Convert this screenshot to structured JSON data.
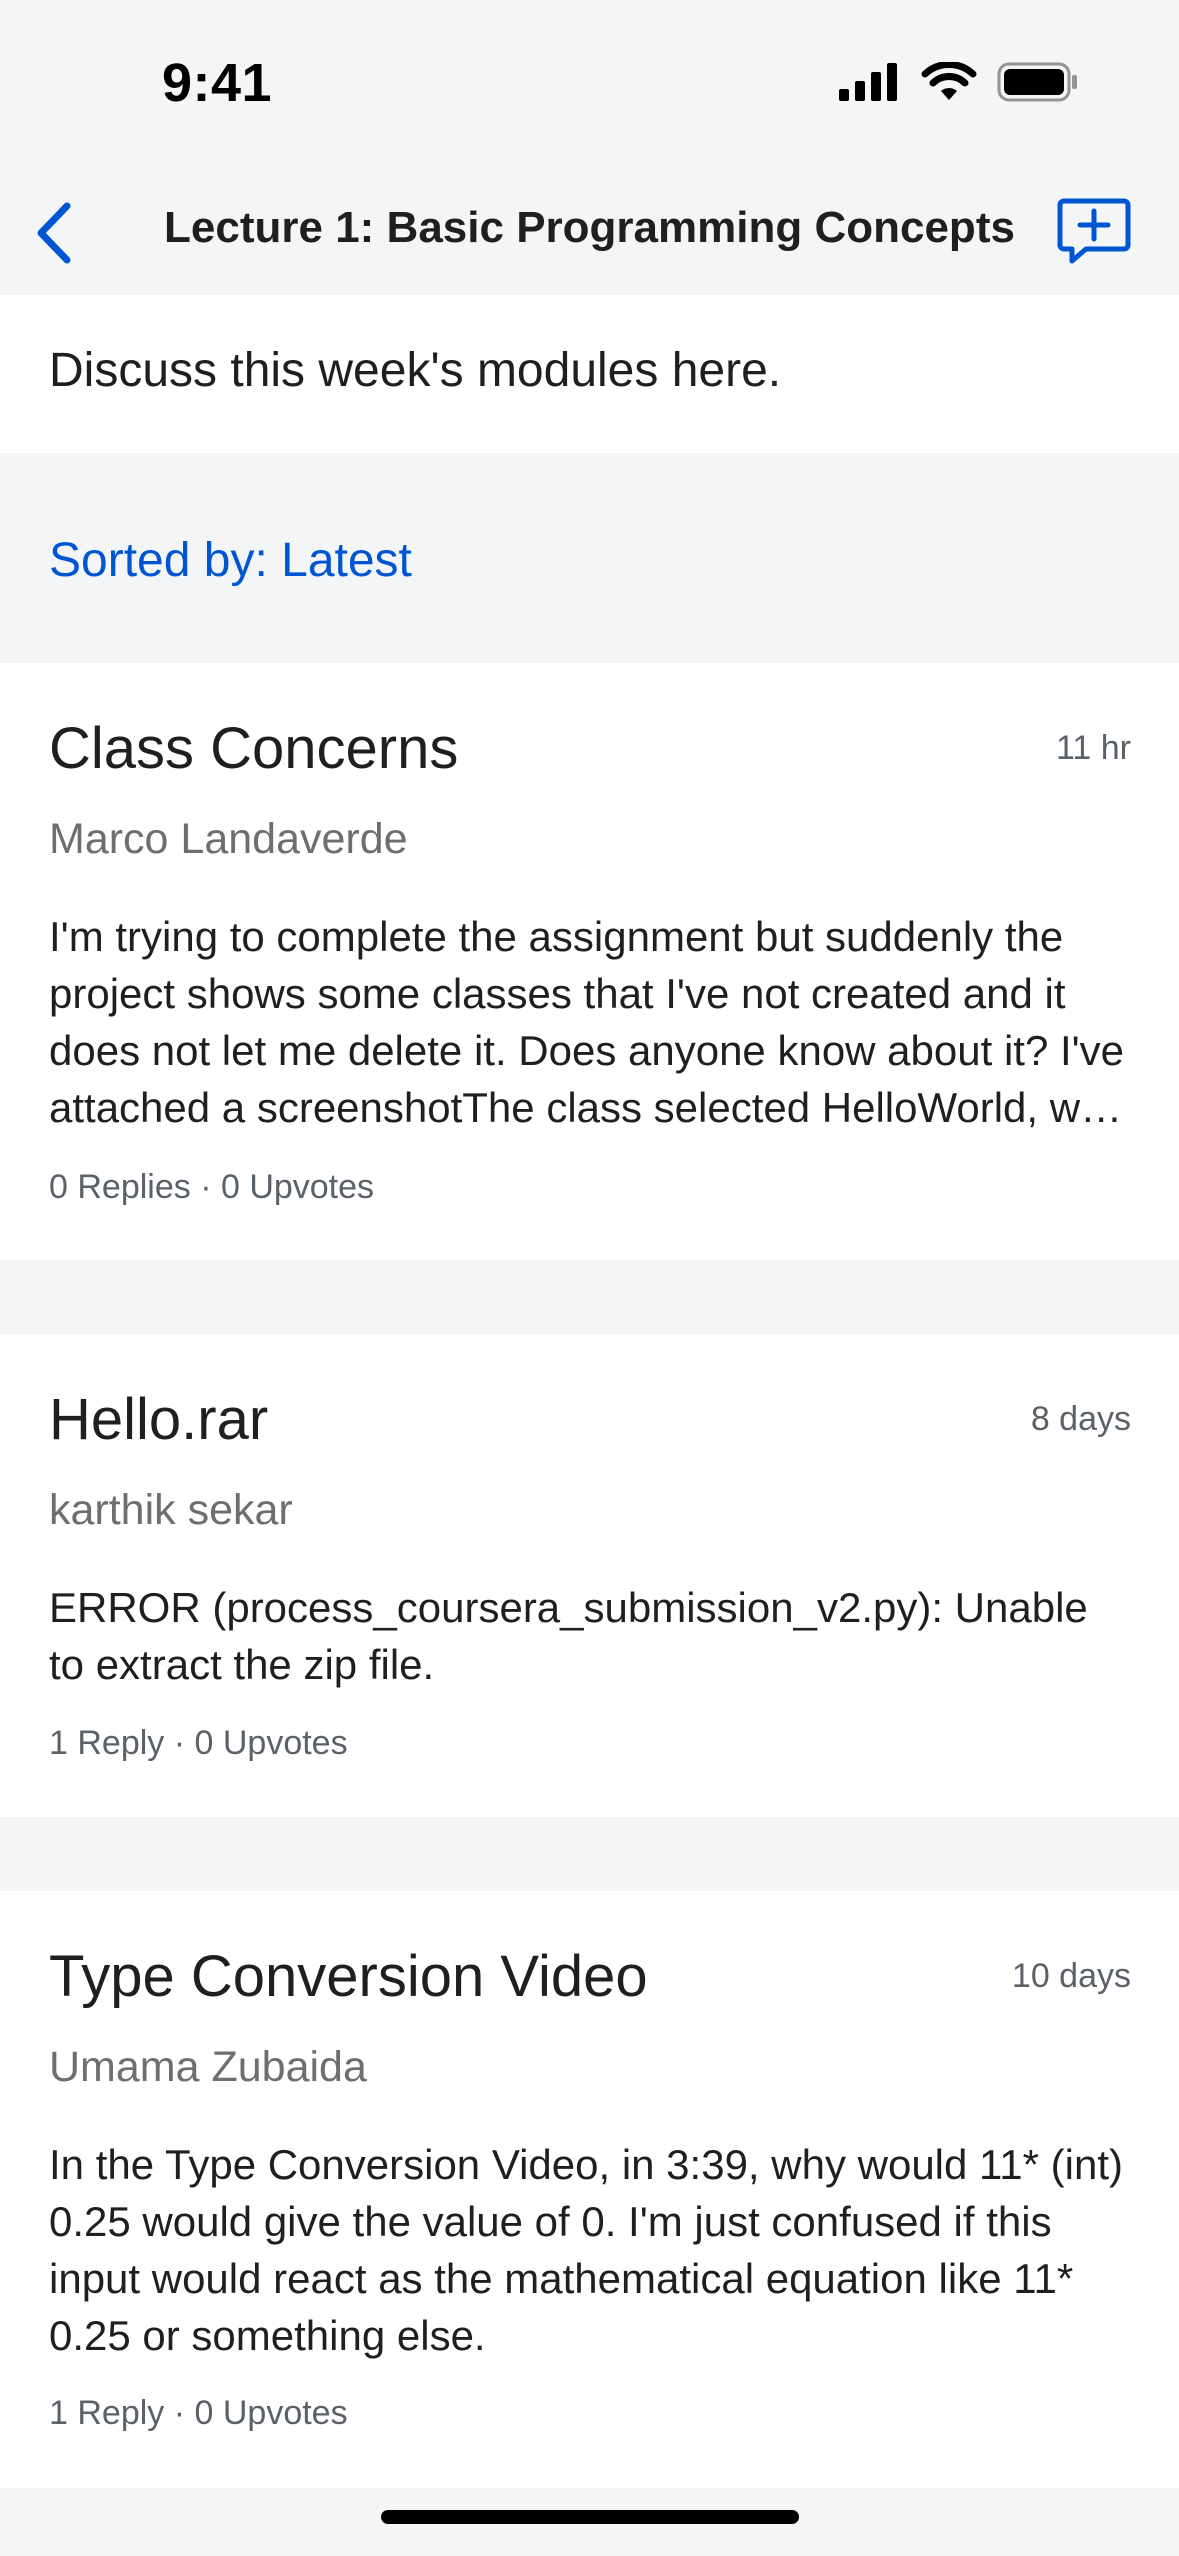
{
  "status_bar": {
    "time": "9:41"
  },
  "nav": {
    "title": "Lecture 1: Basic Programming Concepts",
    "back_icon": "chevron-left-icon",
    "new_thread_icon": "new-discussion-icon"
  },
  "description": "Discuss this week's modules here.",
  "sort": {
    "label": "Sorted by: Latest"
  },
  "threads": [
    {
      "title": "Class Concerns",
      "time": "11 hr",
      "author": "Marco Landaverde",
      "body": "I'm trying to complete the assignment but suddenly the project shows some classes that I've not created and it does not let me delete it. Does anyone know about it? I've attached a screenshotThe class selected HelloWorld, was created by me.",
      "meta": "0 Replies · 0 Upvotes"
    },
    {
      "title": "Hello.rar",
      "time": "8 days",
      "author": "karthik sekar",
      "body": "ERROR (process_coursera_submission_v2.py): Unable to extract the zip file.",
      "meta": "1 Reply · 0 Upvotes"
    },
    {
      "title": "Type Conversion Video",
      "time": "10 days",
      "author": "Umama Zubaida",
      "body": "In the Type Conversion Video, in 3:39, why would 11* (int) 0.25 would give the value of 0. I'm just confused if this input would react as the mathematical equation like 11* 0.25 or something else.",
      "meta": "1 Reply · 0 Upvotes"
    }
  ],
  "colors": {
    "accent": "#0056d2",
    "background": "#f4f5f7",
    "card": "#ffffff",
    "text_primary": "#1f1f1f",
    "text_secondary": "#6e6e6e"
  }
}
